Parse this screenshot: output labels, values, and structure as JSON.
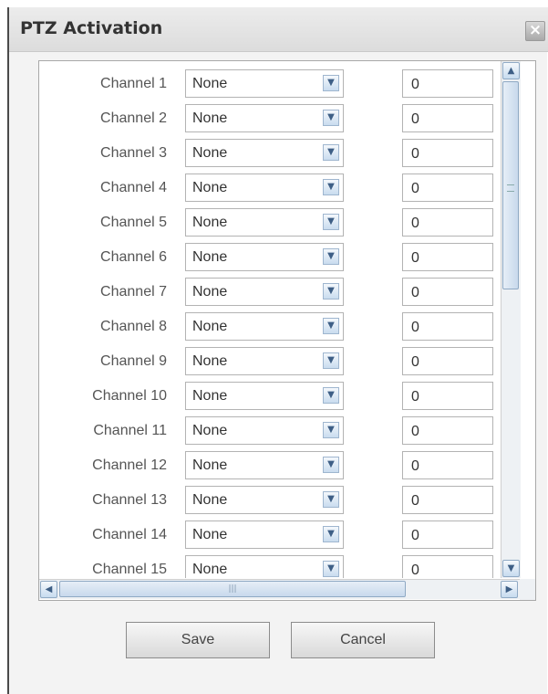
{
  "dialog": {
    "title": "PTZ Activation",
    "close_icon": "×"
  },
  "channels": [
    {
      "label": "Channel 1",
      "type": "None",
      "value": "0"
    },
    {
      "label": "Channel 2",
      "type": "None",
      "value": "0"
    },
    {
      "label": "Channel 3",
      "type": "None",
      "value": "0"
    },
    {
      "label": "Channel 4",
      "type": "None",
      "value": "0"
    },
    {
      "label": "Channel 5",
      "type": "None",
      "value": "0"
    },
    {
      "label": "Channel 6",
      "type": "None",
      "value": "0"
    },
    {
      "label": "Channel 7",
      "type": "None",
      "value": "0"
    },
    {
      "label": "Channel 8",
      "type": "None",
      "value": "0"
    },
    {
      "label": "Channel 9",
      "type": "None",
      "value": "0"
    },
    {
      "label": "Channel 10",
      "type": "None",
      "value": "0"
    },
    {
      "label": "Channel 11",
      "type": "None",
      "value": "0"
    },
    {
      "label": "Channel 12",
      "type": "None",
      "value": "0"
    },
    {
      "label": "Channel 13",
      "type": "None",
      "value": "0"
    },
    {
      "label": "Channel 14",
      "type": "None",
      "value": "0"
    },
    {
      "label": "Channel 15",
      "type": "None",
      "value": "0"
    }
  ],
  "buttons": {
    "save": "Save",
    "cancel": "Cancel"
  },
  "icons": {
    "close": "close-icon",
    "dropdown": "chevron-down-icon",
    "scroll_up": "chevron-up-icon",
    "scroll_down": "chevron-down-icon",
    "scroll_left": "chevron-left-icon",
    "scroll_right": "chevron-right-icon"
  }
}
